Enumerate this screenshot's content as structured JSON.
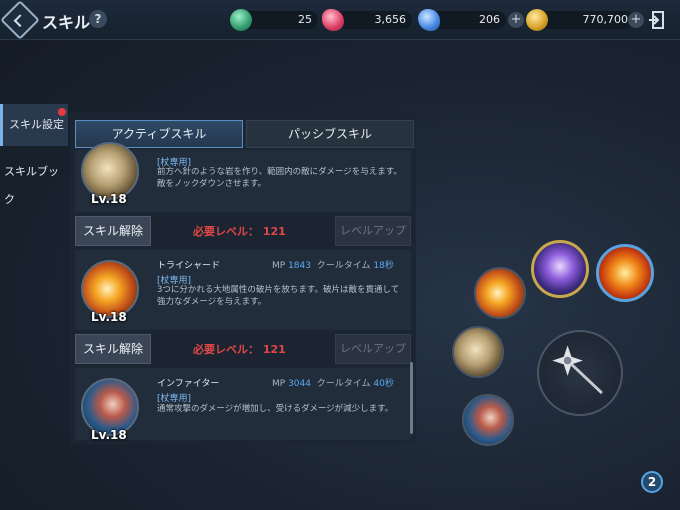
{
  "header": {
    "title": "スキル",
    "help_label": "?",
    "resources": [
      {
        "name": "green-gem",
        "value": "25",
        "color": "#3aa57a"
      },
      {
        "name": "red-crystal",
        "value": "3,656",
        "color": "#e0436b"
      },
      {
        "name": "blue-crystal",
        "value": "206",
        "color": "#4a8de6"
      },
      {
        "name": "gold-coin",
        "value": "770,700",
        "color": "#d9a52b"
      }
    ],
    "plus": "+"
  },
  "side_tabs": [
    {
      "label": "スキル設定",
      "active": true
    },
    {
      "label": "スキルブック",
      "active": false
    }
  ],
  "tabs": {
    "active": "アクティブスキル",
    "passive": "パッシブスキル"
  },
  "skills": [
    {
      "level": "Lv.18",
      "tag": "[杖専用]",
      "desc1": "前方へ針のような岩を作り、範囲内の敵にダメージを与えます。",
      "desc2": "敵をノックダウンさせます。"
    },
    {
      "name": "トライシャード",
      "mp_label": "MP",
      "mp": "1843",
      "cool_label": "クールタイム",
      "cool": "18秒",
      "level": "Lv.18",
      "tag": "[杖専用]",
      "desc1": "3つに分かれる大地属性の破片を放ちます。破片は敵を貫通して",
      "desc2": "強力なダメージを与えます。"
    },
    {
      "name": "インファイター",
      "mp_label": "MP",
      "mp": "3044",
      "cool_label": "クールタイム",
      "cool": "40秒",
      "level": "Lv.18",
      "tag": "[杖専用]",
      "desc1": "通常攻撃のダメージが増加し、受けるダメージが減少します。"
    }
  ],
  "actions": {
    "release": "スキル解除",
    "required_label": "必要レベル： 121",
    "level_up": "レベルアップ"
  },
  "badge": "2"
}
